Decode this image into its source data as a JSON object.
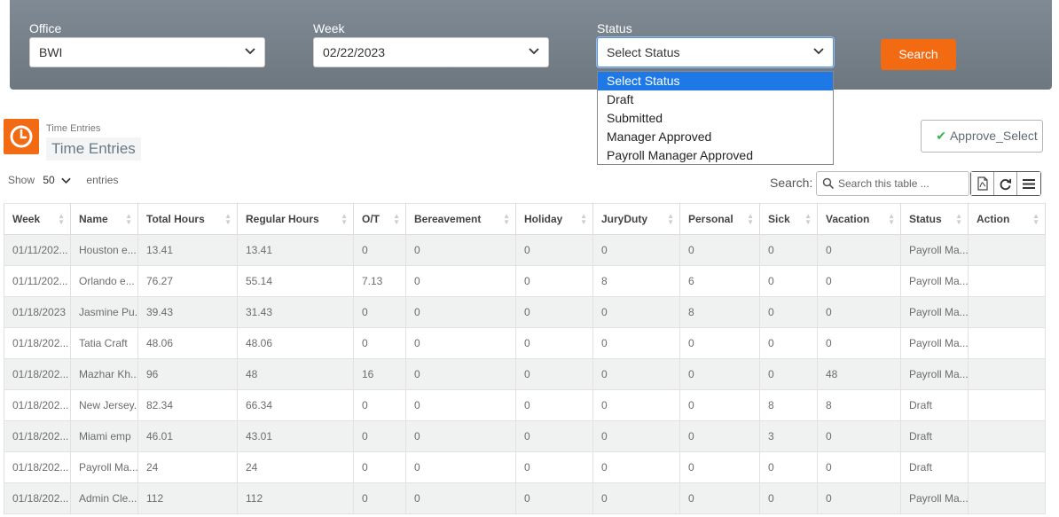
{
  "filters": {
    "office": {
      "label": "Office",
      "value": "BWI"
    },
    "week": {
      "label": "Week",
      "value": "02/22/2023"
    },
    "status": {
      "label": "Status",
      "value": "Select Status",
      "options": [
        "Select Status",
        "Draft",
        "Submitted",
        "Manager Approved",
        "Payroll Manager Approved"
      ]
    },
    "search_label": "Search"
  },
  "header": {
    "breadcrumb": "Time Entries",
    "title": "Time Entries",
    "approve_label": "Approve_Select"
  },
  "table_controls": {
    "show_label": "Show",
    "entries_count": "50",
    "entries_label": "entries",
    "search_label": "Search:",
    "search_placeholder": "Search this table ..."
  },
  "table": {
    "columns": [
      "Week",
      "Name",
      "Total Hours",
      "Regular Hours",
      "O/T",
      "Bereavement",
      "Holiday",
      "JuryDuty",
      "Personal",
      "Sick",
      "Vacation",
      "Status",
      "Action"
    ],
    "rows": [
      [
        "01/11/202...",
        "Houston e...",
        "13.41",
        "13.41",
        "0",
        "0",
        "0",
        "0",
        "0",
        "0",
        "0",
        "Payroll Ma...",
        ""
      ],
      [
        "01/11/202...",
        "Orlando e...",
        "76.27",
        "55.14",
        "7.13",
        "0",
        "0",
        "8",
        "6",
        "0",
        "0",
        "Payroll Ma...",
        ""
      ],
      [
        "01/18/2023",
        "Jasmine Pu...",
        "39.43",
        "31.43",
        "0",
        "0",
        "0",
        "0",
        "8",
        "0",
        "0",
        "Payroll Ma...",
        ""
      ],
      [
        "01/18/202...",
        "Tatia Craft",
        "48.06",
        "48.06",
        "0",
        "0",
        "0",
        "0",
        "0",
        "0",
        "0",
        "Payroll Ma...",
        ""
      ],
      [
        "01/18/202...",
        "Mazhar Kh...",
        "96",
        "48",
        "16",
        "0",
        "0",
        "0",
        "0",
        "0",
        "48",
        "Payroll Ma...",
        ""
      ],
      [
        "01/18/202...",
        "New Jersey...",
        "82.34",
        "66.34",
        "0",
        "0",
        "0",
        "0",
        "0",
        "8",
        "8",
        "Draft",
        ""
      ],
      [
        "01/18/202...",
        "Miami emp",
        "46.01",
        "43.01",
        "0",
        "0",
        "0",
        "0",
        "0",
        "3",
        "0",
        "Draft",
        ""
      ],
      [
        "01/18/202...",
        "Payroll Ma...",
        "24",
        "24",
        "0",
        "0",
        "0",
        "0",
        "0",
        "0",
        "0",
        "Draft",
        ""
      ],
      [
        "01/18/202...",
        "Admin Cle...",
        "112",
        "112",
        "0",
        "0",
        "0",
        "0",
        "0",
        "0",
        "0",
        "Payroll Ma...",
        ""
      ]
    ]
  },
  "colors": {
    "accent": "#f26a12",
    "selected_option": "#1e78e6",
    "panel": "#757f89"
  },
  "icons": {
    "clock": "clock-icon",
    "check": "check-icon",
    "pdf": "pdf-icon",
    "refresh": "refresh-icon",
    "columns": "list-icon",
    "chevron": "chevron-down-icon",
    "search": "search-icon"
  }
}
